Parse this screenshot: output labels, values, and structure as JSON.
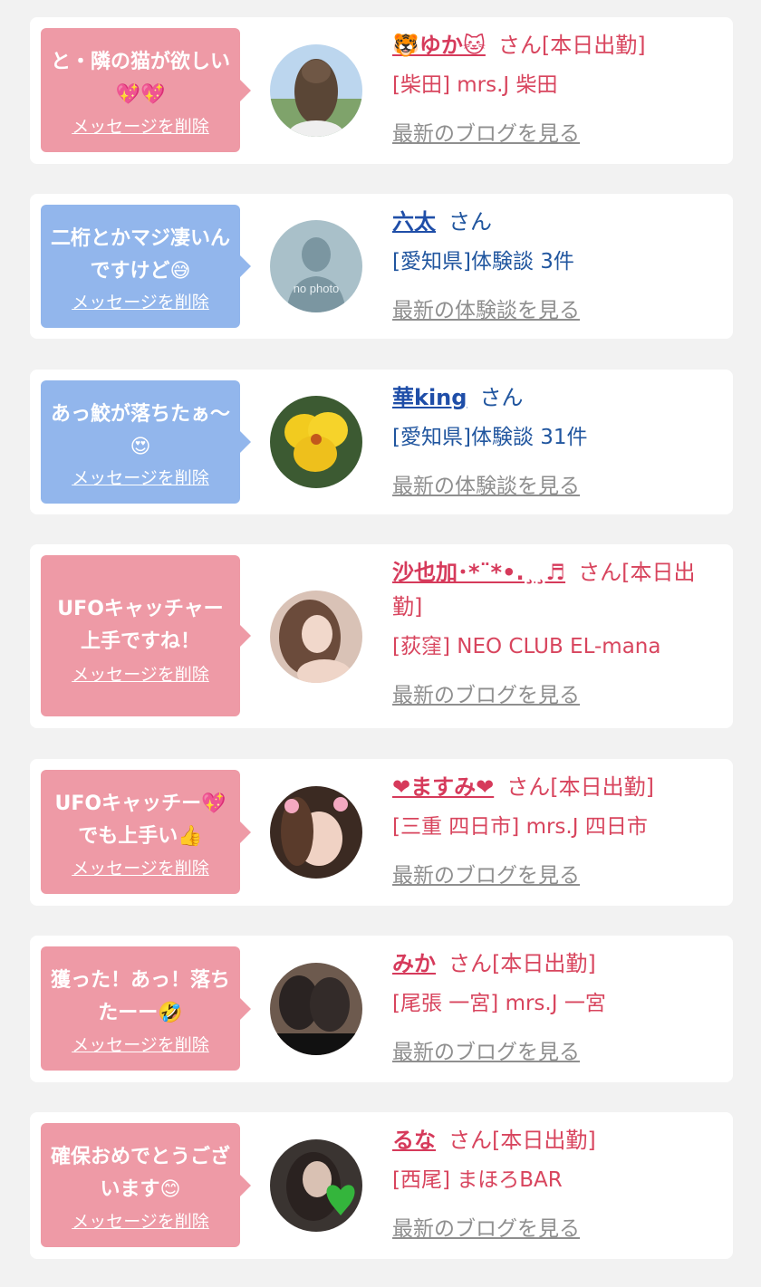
{
  "delete_label": "メッセージを削除",
  "cards": [
    {
      "theme": "pink",
      "message": "と・隣の猫が欲しい💖💖",
      "name": "🐯ゆか🐱",
      "suffix": "さん[本日出勤]",
      "detail": "[柴田] mrs.J 柴田",
      "link": "最新のブログを見る",
      "avatar": "hair-photo"
    },
    {
      "theme": "blue",
      "message": "二桁とかマジ凄いんですけど😅",
      "name": "六太",
      "suffix": "さん",
      "detail": "[愛知県]体験談 3件",
      "link": "最新の体験談を見る",
      "avatar": "no-photo",
      "avatar_text": "no photo"
    },
    {
      "theme": "blue",
      "message": "あっ鮫が落ちたぁ〜😍",
      "name": "華king",
      "suffix": "さん",
      "detail": "[愛知県]体験談 31件",
      "link": "最新の体験談を見る",
      "avatar": "yellow-flower"
    },
    {
      "theme": "pink",
      "message": "UFOキャッチャー上手ですね！",
      "name": "沙也加･*¨*•.¸¸♬",
      "suffix": "さん[本日出勤]",
      "detail": "[荻窪] NEO CLUB EL-mana",
      "link": "最新のブログを見る",
      "avatar": "woman-photo"
    },
    {
      "theme": "pink",
      "message": "UFOキャッチー💖でも上手い👍",
      "name": "❤ますみ❤",
      "suffix": "さん[本日出勤]",
      "detail": "[三重 四日市] mrs.J 四日市",
      "link": "最新のブログを見る",
      "avatar": "woman-filter"
    },
    {
      "theme": "pink",
      "message": "獲った！あっ！落ちたーー🤣",
      "name": "みか",
      "suffix": "さん[本日出勤]",
      "detail": "[尾張 一宮] mrs.J 一宮",
      "link": "最新のブログを見る",
      "avatar": "legs-photo"
    },
    {
      "theme": "pink",
      "message": "確保おめでとうございます😊",
      "name": "るな",
      "suffix": "さん[本日出勤]",
      "detail": "[西尾] まほろBAR",
      "link": "最新のブログを見る",
      "avatar": "heart-photo"
    }
  ]
}
